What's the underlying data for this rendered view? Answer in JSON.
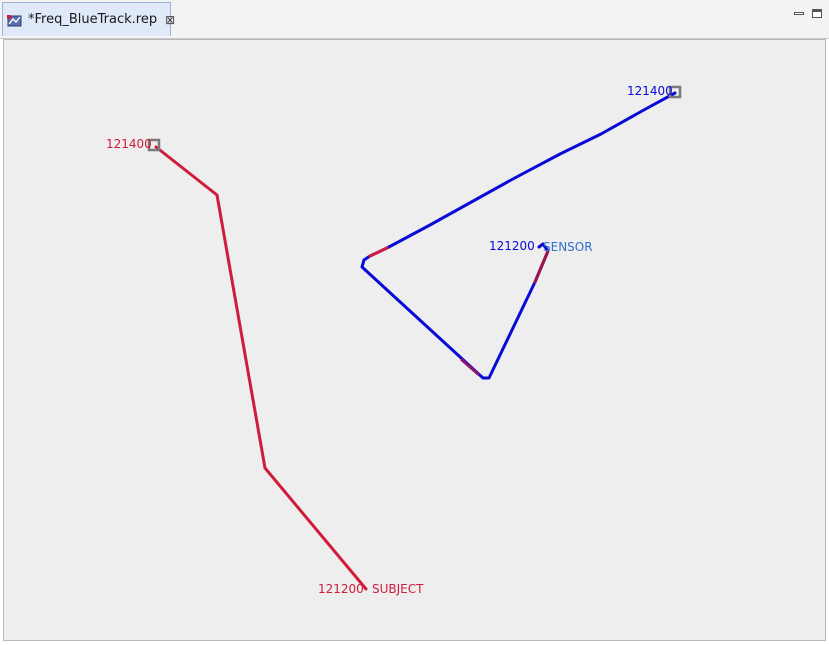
{
  "tab": {
    "title": "*Freq_BlueTrack.rep",
    "close_glyph": "⊠",
    "icon": "map-icon"
  },
  "window_controls": {
    "minimize_icon": "minimize-icon",
    "maximize_icon": "maximize-icon"
  },
  "tracks": {
    "subject": {
      "name": "SUBJECT",
      "start_time": "121200",
      "end_time": "121400",
      "color": "#d01c3c"
    },
    "sensor": {
      "name": "SENSOR",
      "start_time": "121200",
      "end_time": "121400",
      "color": "#0a0ad8",
      "name_color": "#2f6fd0",
      "highlight_color": "#d01c3c"
    }
  },
  "colors": {
    "canvas_background": "#eeeeee",
    "end_marker": "#7a7a7a"
  }
}
